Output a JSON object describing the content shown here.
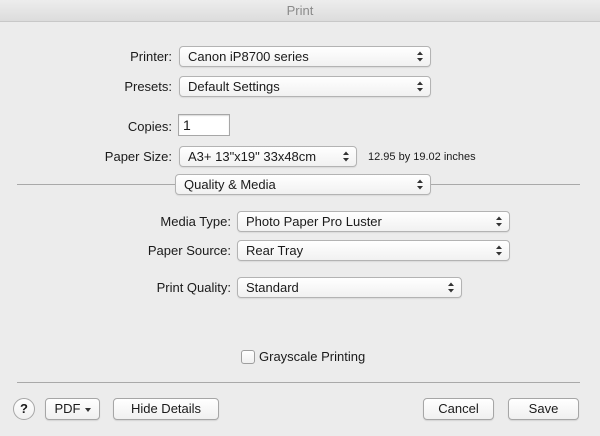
{
  "window": {
    "title": "Print"
  },
  "printer": {
    "label": "Printer:",
    "value": "Canon iP8700 series"
  },
  "presets": {
    "label": "Presets:",
    "value": "Default Settings"
  },
  "copies": {
    "label": "Copies:",
    "value": "1"
  },
  "paper_size": {
    "label": "Paper Size:",
    "value": "A3+ 13\"x19\" 33x48cm",
    "dimensions": "12.95 by 19.02 inches"
  },
  "section": {
    "value": "Quality & Media"
  },
  "media_type": {
    "label": "Media Type:",
    "value": "Photo Paper Pro Luster"
  },
  "paper_source": {
    "label": "Paper Source:",
    "value": "Rear Tray"
  },
  "print_quality": {
    "label": "Print Quality:",
    "value": "Standard"
  },
  "grayscale": {
    "label": "Grayscale Printing",
    "checked": false
  },
  "footer": {
    "help_label": "?",
    "pdf_label": "PDF",
    "hide_details_label": "Hide Details",
    "cancel_label": "Cancel",
    "save_label": "Save"
  }
}
